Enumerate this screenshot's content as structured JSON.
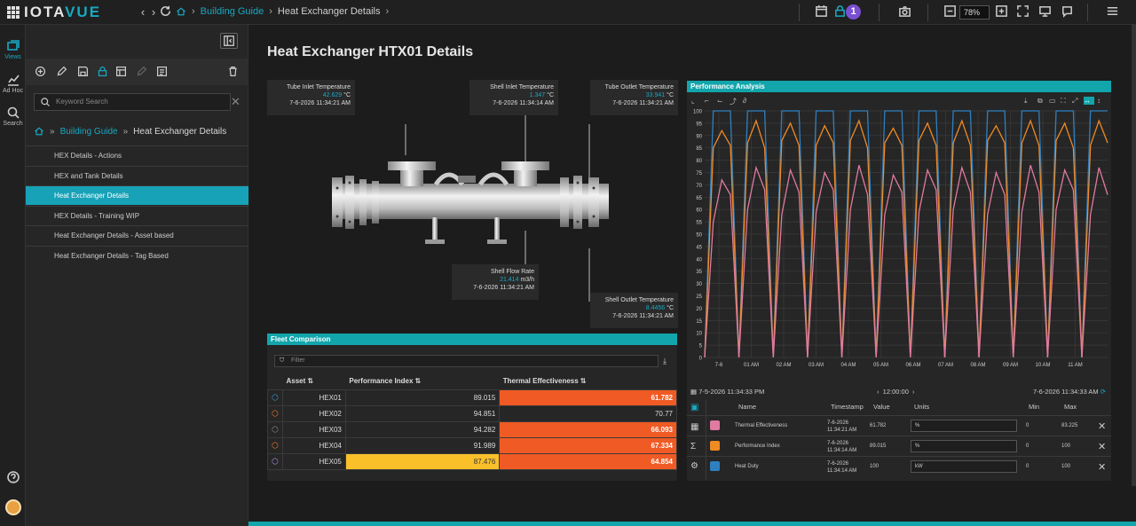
{
  "app": {
    "logo_a": "IOTA",
    "logo_b": "VUE"
  },
  "topbar": {
    "breadcrumb": [
      "Building Guide",
      "Heat Exchanger Details"
    ],
    "notification_count": "1",
    "zoom": "78%"
  },
  "leftbar": {
    "items": [
      {
        "label": "Views",
        "icon": "views-icon"
      },
      {
        "label": "Ad Hoc",
        "icon": "chart-icon"
      },
      {
        "label": "Search",
        "icon": "search-icon"
      }
    ]
  },
  "panel": {
    "search_placeholder": "Keyword Search",
    "breadcrumb": [
      "Building Guide",
      "Heat Exchanger Details"
    ],
    "nav_items": [
      "HEX Details - Actions",
      "HEX and Tank Details",
      "Heat Exchanger Details",
      "HEX Details - Training WIP",
      "Heat Exchanger Details - Asset based",
      "Heat Exchanger Details - Tag Based"
    ],
    "active_index": 2
  },
  "main": {
    "title": "Heat Exchanger HTX01 Details",
    "tags": [
      {
        "label": "Tube Inlet Temperature",
        "value": "42.629",
        "unit": "°C",
        "time": "7-6-2026 11:34:21 AM"
      },
      {
        "label": "Shell Inlet Temperature",
        "value": "1.347",
        "unit": "°C",
        "time": "7-6-2026 11:34:14 AM"
      },
      {
        "label": "Tube Outlet Temperature",
        "value": "33.941",
        "unit": "°C",
        "time": "7-6-2026 11:34:21 AM"
      },
      {
        "label": "Shell Flow Rate",
        "value": "21.414",
        "unit": "m3/h",
        "time": "7-6-2026 11:34:21 AM"
      },
      {
        "label": "Shell Outlet Temperature",
        "value": "8.4456",
        "unit": "°C",
        "time": "7-6-2026 11:34:21 AM"
      }
    ]
  },
  "fleet": {
    "title": "Fleet Comparison",
    "filter_placeholder": "Filter",
    "columns": [
      "Asset",
      "Performance Index",
      "Thermal Effectiveness"
    ],
    "rows": [
      {
        "asset": "HEX01",
        "perf": "89.015",
        "thermal": "61.782",
        "perf_style": "",
        "thermal_style": "orange",
        "icon_color": "#3a9ad9"
      },
      {
        "asset": "HEX02",
        "perf": "94.851",
        "thermal": "70.77",
        "perf_style": "",
        "thermal_style": "",
        "icon_color": "#f07a24"
      },
      {
        "asset": "HEX03",
        "perf": "94.282",
        "thermal": "66.093",
        "perf_style": "",
        "thermal_style": "orange",
        "icon_color": "#888888"
      },
      {
        "asset": "HEX04",
        "perf": "91.989",
        "thermal": "67.334",
        "perf_style": "",
        "thermal_style": "orange",
        "icon_color": "#f07a24"
      },
      {
        "asset": "HEX05",
        "perf": "87.476",
        "thermal": "64.854",
        "perf_style": "yellow",
        "thermal_style": "orange",
        "icon_color": "#a98ee0"
      }
    ]
  },
  "perf": {
    "title": "Performance Analysis",
    "start_time": "7-5-2026 11:34:33 PM",
    "interval": "12:00:00",
    "end_time": "7-6-2026 11:34:33 AM",
    "legend_headers": [
      "Name",
      "Timestamp",
      "Value",
      "Units",
      "Min",
      "Max"
    ],
    "legend_rows": [
      {
        "name": "Thermal Effectiveness",
        "timestamp": "7-6-2026 11:34:21 AM",
        "value": "61.782",
        "unit": "%",
        "min": "0",
        "max": "83.225",
        "color": "#e07aa0"
      },
      {
        "name": "Performance Index",
        "timestamp": "7-6-2026 11:34:14 AM",
        "value": "89.015",
        "unit": "%",
        "min": "0",
        "max": "100",
        "color": "#f08a24"
      },
      {
        "name": "Heat Duty",
        "timestamp": "7-6-2026 11:34:14 AM",
        "value": "100",
        "unit": "kW",
        "min": "0",
        "max": "100",
        "color": "#2f7fc0"
      }
    ]
  },
  "chart_data": {
    "type": "line",
    "x_ticks": [
      "7-6",
      "01 AM",
      "02 AM",
      "03 AM",
      "04 AM",
      "05 AM",
      "06 AM",
      "07 AM",
      "08 AM",
      "09 AM",
      "10 AM",
      "11 AM"
    ],
    "y_ticks": [
      0,
      5,
      10,
      15,
      20,
      25,
      30,
      35,
      40,
      45,
      50,
      55,
      60,
      65,
      70,
      75,
      80,
      85,
      90,
      95,
      100
    ],
    "ylim": [
      0,
      100
    ],
    "grid": true,
    "series": [
      {
        "name": "Heat Duty",
        "color": "#2f7fc0",
        "values": [
          0,
          100,
          100,
          100,
          0,
          100,
          100,
          100,
          0,
          100,
          100,
          100,
          0,
          100,
          100,
          100,
          0,
          100,
          100,
          100,
          0,
          100,
          100,
          100,
          0,
          100,
          100,
          100,
          0,
          100,
          100,
          100,
          0,
          100,
          100,
          100,
          0,
          100,
          100,
          100,
          0,
          100,
          100,
          100,
          0,
          100,
          100,
          100
        ]
      },
      {
        "name": "Performance Index",
        "color": "#f08a24",
        "values": [
          0,
          85,
          92,
          86,
          0,
          87,
          96,
          85,
          0,
          88,
          95,
          86,
          0,
          86,
          94,
          87,
          0,
          88,
          96,
          85,
          0,
          87,
          93,
          86,
          0,
          88,
          95,
          86,
          0,
          87,
          96,
          86,
          0,
          88,
          94,
          87,
          0,
          87,
          96,
          86,
          0,
          88,
          95,
          85,
          0,
          86,
          96,
          87
        ]
      },
      {
        "name": "Thermal Effectiveness",
        "color": "#e07aa0",
        "values": [
          0,
          55,
          72,
          66,
          0,
          60,
          77,
          68,
          0,
          58,
          76,
          67,
          0,
          59,
          75,
          68,
          0,
          60,
          78,
          66,
          0,
          58,
          74,
          67,
          0,
          59,
          76,
          68,
          0,
          60,
          77,
          67,
          0,
          58,
          75,
          66,
          0,
          59,
          78,
          67,
          0,
          60,
          76,
          68,
          0,
          58,
          77,
          66
        ]
      }
    ]
  }
}
